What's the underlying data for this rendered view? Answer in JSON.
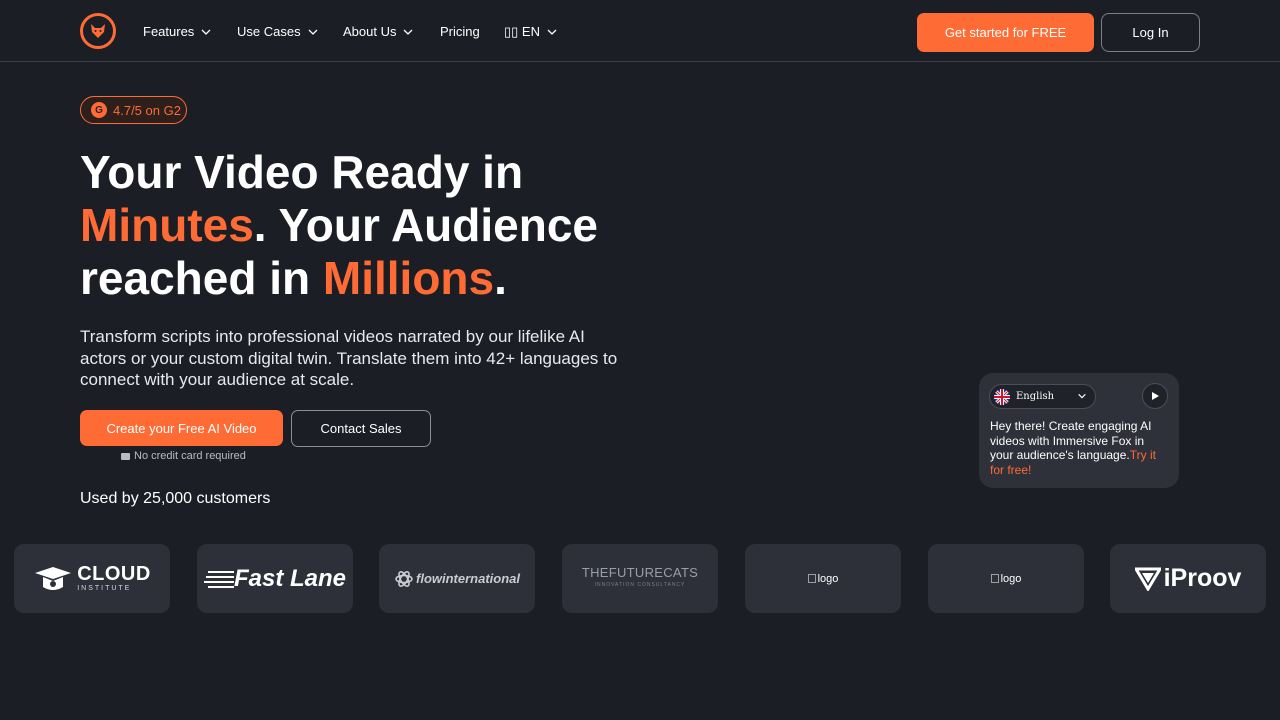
{
  "nav": {
    "items": [
      {
        "label": "Features",
        "has_dropdown": true
      },
      {
        "label": "Use Cases",
        "has_dropdown": true
      },
      {
        "label": "About Us",
        "has_dropdown": true
      },
      {
        "label": "Pricing",
        "has_dropdown": false
      },
      {
        "label": "▯▯ EN",
        "has_dropdown": true
      }
    ],
    "cta_label": "Get started for FREE",
    "login_label": "Log In"
  },
  "hero": {
    "rating": "4.7/5 on G2",
    "headline_1": "Your Video Ready in",
    "headline_2_accent": "Minutes",
    "headline_2_rest": ". Your Audience",
    "headline_3_start": "reached in ",
    "headline_3_accent": "Millions",
    "headline_3_end": ".",
    "subtext": "Transform scripts into professional videos narrated by our lifelike AI actors or your custom digital twin. Translate them into 42+ languages to connect with your audience at scale.",
    "cta_primary": "Create your Free AI Video",
    "cta_secondary": "Contact Sales",
    "no_card": "No credit card required",
    "used_by": "Used by 25,000 customers"
  },
  "chat_card": {
    "language": "English",
    "message": "Hey there! Create engaging AI videos with Immersive Fox in your audience's language.",
    "link": "Try it for free!"
  },
  "logos": {
    "cloud": "CLOUD",
    "cloud_sub": "INSTITUTE",
    "fastlane": "Fast Lane",
    "flow": "flowinternational",
    "futurecats": "THEFUTURECATS",
    "futurecats_sub": "INNOVATION CONSULTANCY",
    "broken_alt": "logo",
    "iproov": "iProov"
  },
  "colors": {
    "background": "#1b1e25",
    "accent": "#ff6b35",
    "card": "#2d3038"
  }
}
